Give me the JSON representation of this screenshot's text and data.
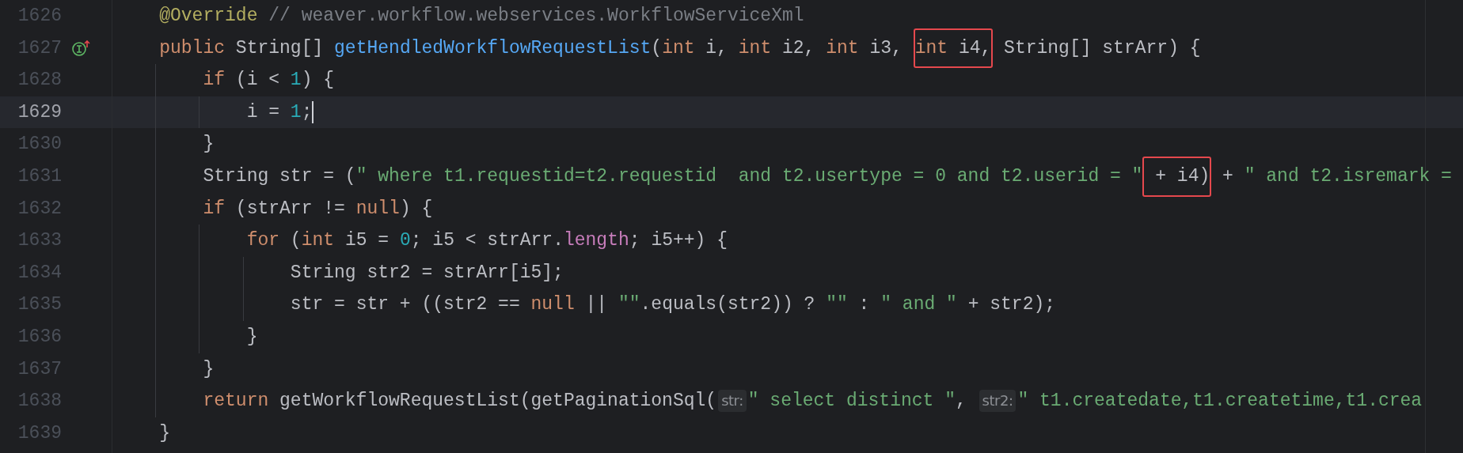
{
  "editor": {
    "lines": [
      {
        "number": "1626",
        "current": false,
        "implementation_marker": false,
        "tokens": [
          {
            "kind": "annotation",
            "text": "    @Override"
          },
          {
            "kind": "comment",
            "text": " // weaver.workflow.webservices.WorkflowServiceXml"
          }
        ]
      },
      {
        "number": "1627",
        "current": false,
        "implementation_marker": true,
        "tokens": [
          {
            "kind": "keyword",
            "text": "    public"
          },
          {
            "kind": "plain",
            "text": " String[] "
          },
          {
            "kind": "function",
            "text": "getHendledWorkflowRequestList"
          },
          {
            "kind": "plain",
            "text": "("
          },
          {
            "kind": "keyword",
            "text": "int"
          },
          {
            "kind": "plain",
            "text": " i, "
          },
          {
            "kind": "keyword",
            "text": "int"
          },
          {
            "kind": "plain",
            "text": " i2, "
          },
          {
            "kind": "keyword",
            "text": "int"
          },
          {
            "kind": "plain",
            "text": " i3, "
          },
          {
            "kind": "box",
            "tokens": [
              {
                "kind": "keyword",
                "text": "int"
              },
              {
                "kind": "plain",
                "text": " i4,"
              }
            ]
          },
          {
            "kind": "plain",
            "text": " String[] strArr) {"
          }
        ]
      },
      {
        "number": "1628",
        "current": false,
        "implementation_marker": false,
        "tokens": [
          {
            "kind": "keyword",
            "text": "        if"
          },
          {
            "kind": "plain",
            "text": " (i < "
          },
          {
            "kind": "number",
            "text": "1"
          },
          {
            "kind": "plain",
            "text": ") {"
          }
        ]
      },
      {
        "number": "1629",
        "current": true,
        "implementation_marker": false,
        "tokens": [
          {
            "kind": "plain",
            "text": "            i = "
          },
          {
            "kind": "number",
            "text": "1"
          },
          {
            "kind": "plain",
            "text": ";"
          }
        ]
      },
      {
        "number": "1630",
        "current": false,
        "implementation_marker": false,
        "tokens": [
          {
            "kind": "plain",
            "text": "        }"
          }
        ]
      },
      {
        "number": "1631",
        "current": false,
        "implementation_marker": false,
        "tokens": [
          {
            "kind": "plain",
            "text": "        String str = ("
          },
          {
            "kind": "string",
            "text": "\" where t1.requestid=t2.requestid  and t2.usertype = 0 and t2.userid = \""
          },
          {
            "kind": "box",
            "tokens": [
              {
                "kind": "plain",
                "text": " + i4)"
              }
            ]
          },
          {
            "kind": "plain",
            "text": " + "
          },
          {
            "kind": "string",
            "text": "\" and t2.isremark ="
          }
        ]
      },
      {
        "number": "1632",
        "current": false,
        "implementation_marker": false,
        "tokens": [
          {
            "kind": "keyword",
            "text": "        if"
          },
          {
            "kind": "plain",
            "text": " (strArr != "
          },
          {
            "kind": "keyword",
            "text": "null"
          },
          {
            "kind": "plain",
            "text": ") {"
          }
        ]
      },
      {
        "number": "1633",
        "current": false,
        "implementation_marker": false,
        "tokens": [
          {
            "kind": "keyword",
            "text": "            for"
          },
          {
            "kind": "plain",
            "text": " ("
          },
          {
            "kind": "keyword",
            "text": "int"
          },
          {
            "kind": "plain",
            "text": " i5 = "
          },
          {
            "kind": "number",
            "text": "0"
          },
          {
            "kind": "plain",
            "text": "; i5 < strArr."
          },
          {
            "kind": "field",
            "text": "length"
          },
          {
            "kind": "plain",
            "text": "; i5++) {"
          }
        ]
      },
      {
        "number": "1634",
        "current": false,
        "implementation_marker": false,
        "tokens": [
          {
            "kind": "plain",
            "text": "                String str2 = strArr[i5];"
          }
        ]
      },
      {
        "number": "1635",
        "current": false,
        "implementation_marker": false,
        "tokens": [
          {
            "kind": "plain",
            "text": "                str = str + ((str2 == "
          },
          {
            "kind": "keyword",
            "text": "null"
          },
          {
            "kind": "plain",
            "text": " || "
          },
          {
            "kind": "string",
            "text": "\"\""
          },
          {
            "kind": "plain",
            "text": ".equals(str2)) ? "
          },
          {
            "kind": "string",
            "text": "\"\""
          },
          {
            "kind": "plain",
            "text": " : "
          },
          {
            "kind": "string",
            "text": "\" and \""
          },
          {
            "kind": "plain",
            "text": " + str2);"
          }
        ]
      },
      {
        "number": "1636",
        "current": false,
        "implementation_marker": false,
        "tokens": [
          {
            "kind": "plain",
            "text": "            }"
          }
        ]
      },
      {
        "number": "1637",
        "current": false,
        "implementation_marker": false,
        "tokens": [
          {
            "kind": "plain",
            "text": "        }"
          }
        ]
      },
      {
        "number": "1638",
        "current": false,
        "implementation_marker": false,
        "tokens": [
          {
            "kind": "keyword",
            "text": "        return"
          },
          {
            "kind": "plain",
            "text": " getWorkflowRequestList(getPaginationSql("
          },
          {
            "kind": "hint",
            "text": "str:"
          },
          {
            "kind": "string",
            "text": "\" select distinct \""
          },
          {
            "kind": "plain",
            "text": ", "
          },
          {
            "kind": "hint",
            "text": "str2:"
          },
          {
            "kind": "string",
            "text": "\" t1.createdate,t1.createtime,t1.crea"
          }
        ]
      },
      {
        "number": "1639",
        "current": false,
        "implementation_marker": false,
        "tokens": [
          {
            "kind": "plain",
            "text": "    }"
          }
        ]
      }
    ]
  }
}
